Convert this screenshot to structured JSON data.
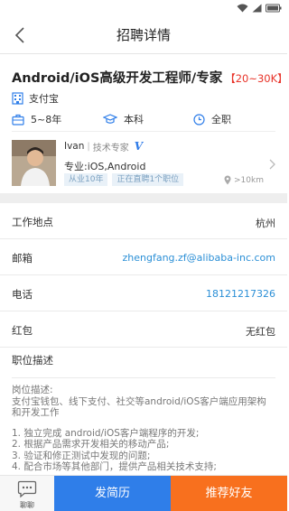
{
  "header": {
    "title": "招聘详情"
  },
  "job": {
    "title": "Android/iOS高级开发工程师/专家",
    "salary": "【20~30K】",
    "company": "支付宝",
    "experience": "5~8年",
    "education": "本科",
    "job_type": "全职"
  },
  "recruiter": {
    "name": "Ivan",
    "title": "技术专家",
    "badge": "V",
    "specialty": "专业:iOS,Android",
    "tags": [
      "从业10年",
      "正在直聘1个职位"
    ],
    "distance": ">10km"
  },
  "details": [
    {
      "label": "工作地点",
      "value": "杭州",
      "link": false
    },
    {
      "label": "邮箱",
      "value": "zhengfang.zf@alibaba-inc.com",
      "link": true
    },
    {
      "label": "电话",
      "value": "18121217326",
      "link": true
    },
    {
      "label": "红包",
      "value": "无红包",
      "link": false
    }
  ],
  "description": {
    "label": "职位描述",
    "intro": [
      "岗位描述:",
      "支付宝钱包、线下支付、社交等android/iOS客户端应用架构和开发工作"
    ],
    "items": [
      "1. 独立完成 android/iOS客户端程序的开发;",
      "2. 根据产品需求开发相关的移动产品;",
      "3. 验证和修正测试中发现的问题;",
      "4. 配合市场等其他部门，提供产品相关技术支持;"
    ]
  },
  "actions": {
    "chat": "聊聊",
    "send_resume": "发简历",
    "recommend": "推荐好友"
  },
  "colors": {
    "salary": "#e8342a",
    "link": "#2b8fd6",
    "send_button": "#2f7ee9",
    "recommend_button": "#f8701e",
    "badge": "#2f7be8"
  }
}
